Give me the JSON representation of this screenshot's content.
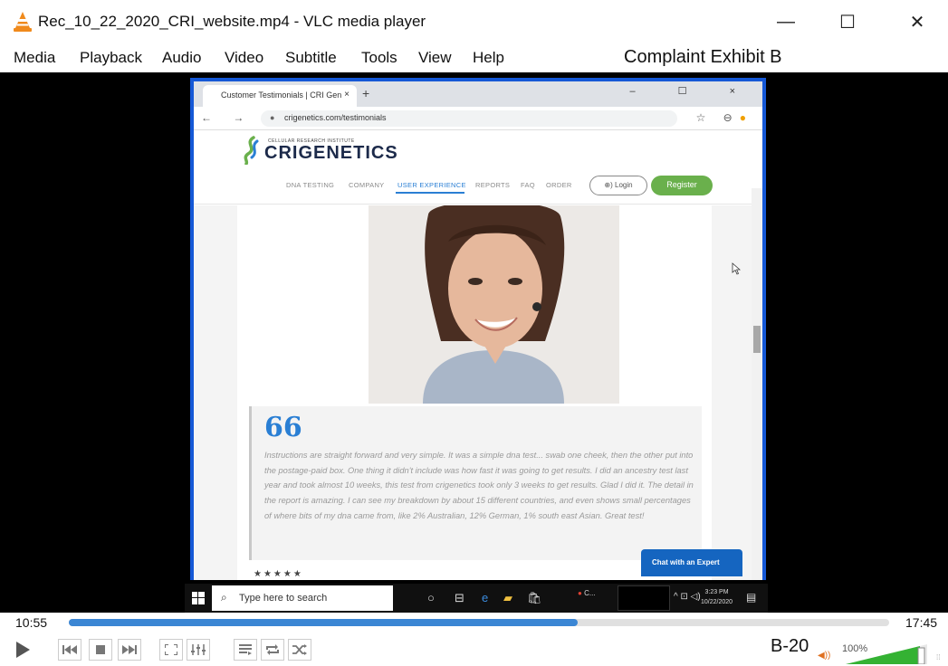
{
  "window": {
    "title": "Rec_10_22_2020_CRI_website.mp4 - VLC media player",
    "minimize_glyph": "—",
    "maximize_glyph": "☐",
    "close_glyph": "✕"
  },
  "menu": [
    "Media",
    "Playback",
    "Audio",
    "Video",
    "Subtitle",
    "Tools",
    "View",
    "Help"
  ],
  "exhibit_label": "Complaint Exhibit B",
  "exhibit_number": "B-20",
  "browser": {
    "tab_title": "Customer Testimonials | CRI Gen",
    "tab_close": "×",
    "new_tab": "+",
    "window_controls": "– ☐ ×",
    "nav_buttons": "← → C",
    "url": "crigenetics.com/testimonials",
    "addr_icons": "☆ ⊖"
  },
  "site": {
    "logo_sub": "CELLULAR RESEARCH INSTITUTE",
    "logo_cri": "CRI",
    "logo_genetics": "GENETICS",
    "nav": [
      "DNA TESTING",
      "COMPANY",
      "USER EXPERIENCE",
      "REPORTS",
      "FAQ",
      "ORDER"
    ],
    "active_nav": "USER EXPERIENCE",
    "login": "⊕) Login",
    "register": "Register",
    "quote_mark": "66",
    "testimonial": "Instructions are straight forward and very simple. It was a simple dna test... swab one cheek, then the other put into the postage-paid box. One thing it didn't include was how fast it was going to get results. I did an ancestry test last year and took almost 10 weeks, this test from crigenetics took only 3 weeks to get results. Glad I did it. The detail in the report is amazing. I can see my breakdown by about 15 different countries, and even shows small percentages of where bits of my dna came from, like 2% Australian, 12% German, 1% south east Asian. Great test!",
    "chat_button": "Chat with an Expert"
  },
  "taskbar": {
    "search_placeholder": "Type here to search",
    "chrome_label": "C...",
    "clock_time": "3:23 PM",
    "clock_date": "10/22/2020"
  },
  "player": {
    "current_time": "10:55",
    "total_time": "17:45",
    "progress_fraction": 0.62,
    "volume": "100%",
    "accent_color": "#3b86d4",
    "volume_color": "#34b233"
  },
  "icons": {
    "app": "vlc-cone-icon",
    "play": "play-icon",
    "prev": "previous-icon",
    "stop": "stop-icon",
    "next": "next-icon",
    "fullscreen": "fullscreen-icon",
    "extended": "extended-settings-icon",
    "playlist": "playlist-icon",
    "loop": "loop-icon",
    "shuffle": "shuffle-icon"
  }
}
